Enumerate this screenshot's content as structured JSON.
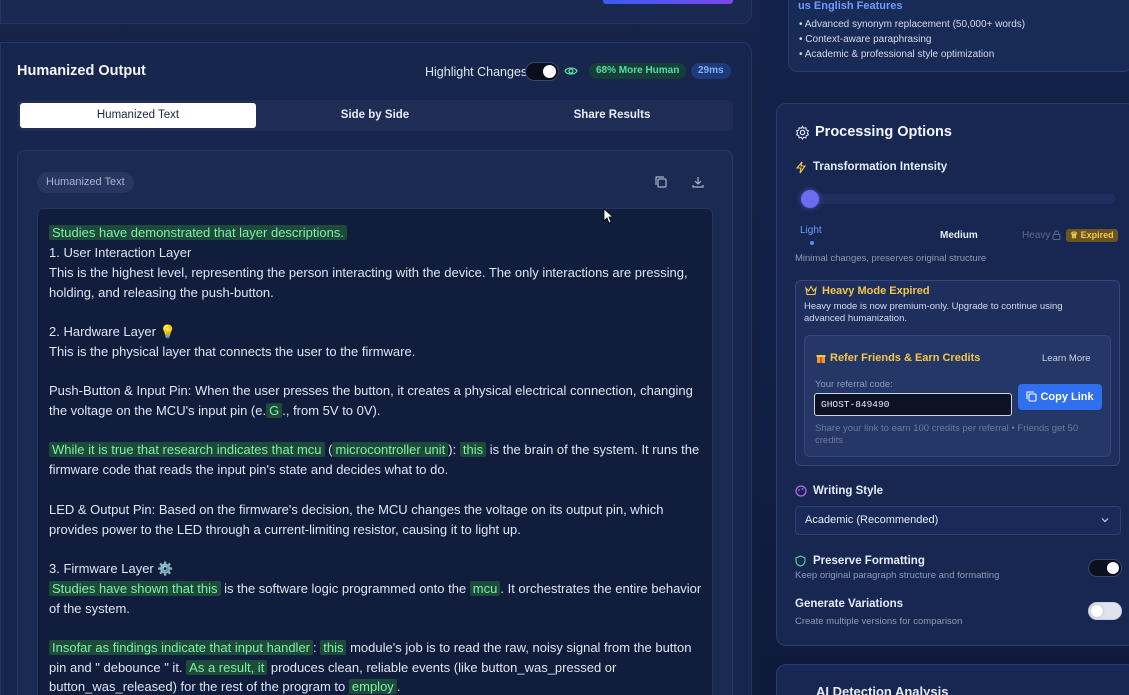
{
  "header": {
    "title": "Humanized Output",
    "highlight_label": "Highlight Changes",
    "badge_human": "68% More Human",
    "badge_time": "29ms"
  },
  "tabs": [
    {
      "label": "Humanized Text",
      "active": true
    },
    {
      "label": "Side by Side",
      "active": false
    },
    {
      "label": "Share Results",
      "active": false
    }
  ],
  "output": {
    "chip": "Humanized Text",
    "paragraphs": [
      {
        "segments": [
          {
            "t": "Studies have demonstrated that layer descriptions.",
            "h": true
          }
        ]
      },
      {
        "segments": [
          {
            "t": "1. User Interaction Layer",
            "h": false
          }
        ]
      },
      {
        "segments": [
          {
            "t": "This is the highest level, representing the person interacting with the device. The only interactions are pressing, holding, and releasing the push-button.",
            "h": false
          }
        ]
      },
      {
        "segments": [
          {
            "t": "2. Hardware Layer 💡",
            "h": false
          }
        ]
      },
      {
        "segments": [
          {
            "t": "This is the physical layer that connects the user to the firmware.",
            "h": false
          }
        ]
      },
      {
        "segments": [
          {
            "t": "Push-Button & Input Pin: When the user presses the button, it creates a physical electrical connection, changing the voltage on the MCU's input pin (e.",
            "h": false
          },
          {
            "t": "G",
            "h": true
          },
          {
            "t": "., from 5V to 0V).",
            "h": false
          }
        ]
      },
      {
        "segments": [
          {
            "t": "While it is true that research indicates that mcu",
            "h": true
          },
          {
            "t": " (",
            "h": false
          },
          {
            "t": "microcontroller unit",
            "h": true
          },
          {
            "t": "): ",
            "h": false
          },
          {
            "t": "this",
            "h": true
          },
          {
            "t": " is the brain of the system. It runs the firmware code that reads the input pin's state and decides what to do.",
            "h": false
          }
        ]
      },
      {
        "segments": [
          {
            "t": "LED & Output Pin: Based on the firmware's decision, the MCU changes the voltage on its output pin, which provides power to the LED through a current-limiting resistor, causing it to light up.",
            "h": false
          }
        ]
      },
      {
        "segments": [
          {
            "t": "3. Firmware Layer ⚙️",
            "h": false
          }
        ]
      },
      {
        "segments": [
          {
            "t": "Studies have shown that this",
            "h": true
          },
          {
            "t": " is the software logic programmed onto the ",
            "h": false
          },
          {
            "t": "mcu",
            "h": true
          },
          {
            "t": ". It orchestrates the entire behavior of the system.",
            "h": false
          }
        ]
      },
      {
        "segments": [
          {
            "t": "Insofar as findings indicate that input handler",
            "h": true
          },
          {
            "t": ": ",
            "h": false
          },
          {
            "t": "this",
            "h": true
          },
          {
            "t": " module's job is to read the raw, noisy signal from the button pin and \" debounce \" it. ",
            "h": false
          },
          {
            "t": "As a result, it",
            "h": true
          },
          {
            "t": " produces clean, reliable events (like button_was_pressed or button_was_released) for the rest of the program to ",
            "h": false
          },
          {
            "t": "employ",
            "h": true
          },
          {
            "t": ".",
            "h": false
          }
        ]
      }
    ]
  },
  "features": {
    "title": "us English Features",
    "items": [
      "• Advanced synonym replacement (50,000+ words)",
      "• Context-aware paraphrasing",
      "• Academic & professional style optimization"
    ]
  },
  "processing": {
    "title": "Processing Options",
    "intensity_label": "Transformation Intensity",
    "intensity_level": 0,
    "levels": [
      "Light",
      "Medium",
      "Heavy"
    ],
    "expired_badge": "Expired",
    "intensity_hint": "Minimal changes, preserves original structure",
    "heavy_title": "Heavy Mode Expired",
    "heavy_desc": "Heavy mode is now premium-only. Upgrade to continue using advanced humanization.",
    "refer_title": "Refer Friends & Earn Credits",
    "learn_more": "Learn More",
    "referral_label": "Your referral code:",
    "referral_code": "GHOST-849490",
    "copy_link": "Copy Link",
    "referral_hint": "Share your link to earn 100 credits per referral • Friends get 50 credits",
    "writing_style_label": "Writing Style",
    "writing_style_value": "Academic (Recommended)",
    "preserve_label": "Preserve Formatting",
    "preserve_hint": "Keep original paragraph structure and formatting",
    "preserve_on": true,
    "variations_label": "Generate Variations",
    "variations_hint": "Create multiple versions for comparison",
    "variations_on": false
  },
  "bottom": {
    "title": "AI Detection Analysis"
  },
  "colors": {
    "accent": "#2f6ff0",
    "highlight_bg": "#1d4a3a",
    "highlight_text": "#7ff0a8",
    "premium": "#f2c64a"
  }
}
